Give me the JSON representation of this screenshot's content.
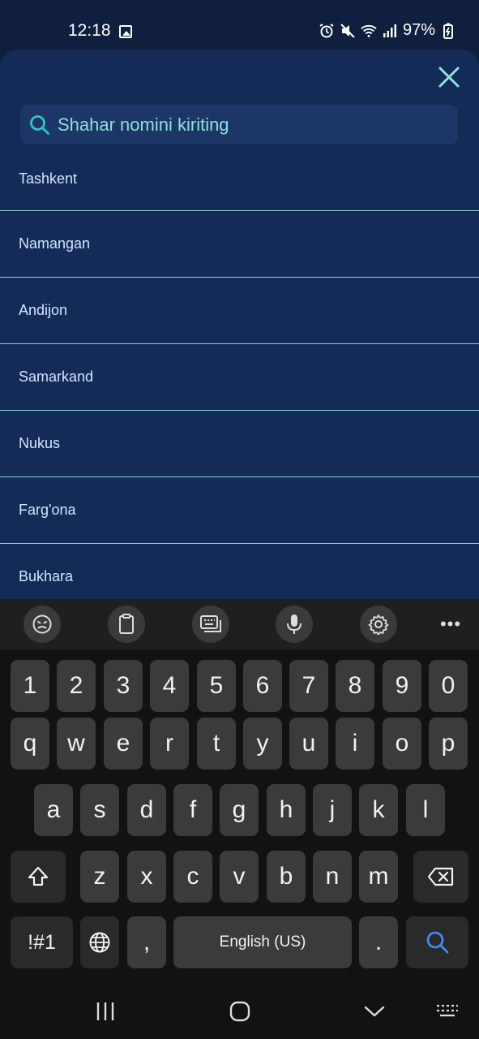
{
  "status_bar": {
    "time": "12:18",
    "battery_percent": "97%",
    "icons": [
      "image-icon",
      "alarm-icon",
      "mute-icon",
      "wifi-icon",
      "signal-icon",
      "battery-charging-icon"
    ]
  },
  "sheet": {
    "close_icon": "close-icon",
    "search": {
      "placeholder": "Shahar nomini kiriting",
      "icon": "search-icon"
    },
    "cities": [
      "Tashkent",
      "Namangan",
      "Andijon",
      "Samarkand",
      "Nukus",
      "Farg'ona",
      "Bukhara"
    ]
  },
  "keyboard_toolbar": {
    "items": [
      "emoji-icon",
      "clipboard-icon",
      "keyboard-layout-icon",
      "microphone-icon",
      "settings-icon",
      "more-icon"
    ],
    "more_label": "•••"
  },
  "keyboard": {
    "row_numbers": [
      "1",
      "2",
      "3",
      "4",
      "5",
      "6",
      "7",
      "8",
      "9",
      "0"
    ],
    "row_top": [
      "q",
      "w",
      "e",
      "r",
      "t",
      "y",
      "u",
      "i",
      "o",
      "p"
    ],
    "row_middle": [
      "a",
      "s",
      "d",
      "f",
      "g",
      "h",
      "j",
      "k",
      "l"
    ],
    "row_bottom": [
      "z",
      "x",
      "c",
      "v",
      "b",
      "n",
      "m"
    ],
    "symbols_label": "!#1",
    "comma_label": ",",
    "space_label": "English (US)",
    "period_label": "."
  },
  "nav_bar": {
    "items": [
      "recents-icon",
      "home-icon",
      "back-icon",
      "keyboard-hide-icon"
    ]
  },
  "colors": {
    "sheet_bg": "#142a57",
    "accent": "#2fc6c0",
    "divider": "#8fd3d1",
    "search_bg": "#1c3668"
  }
}
